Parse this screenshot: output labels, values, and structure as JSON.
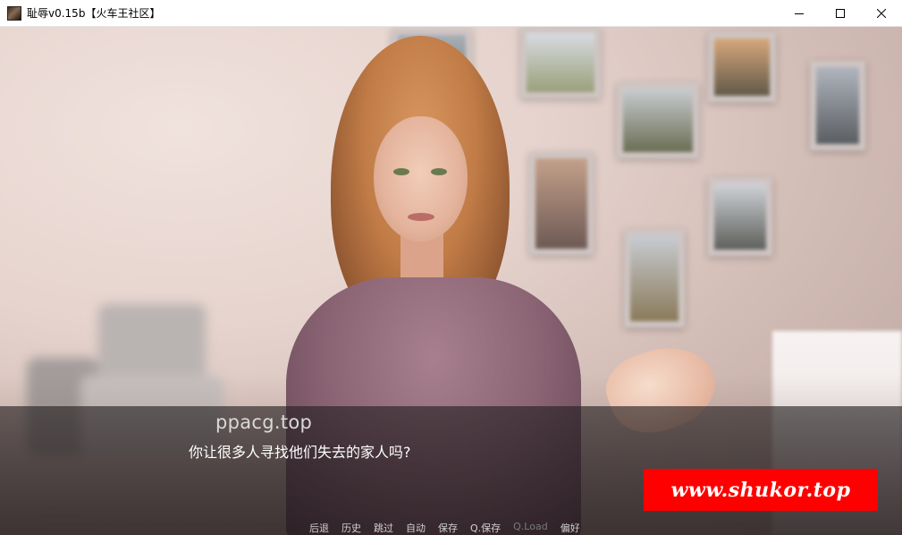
{
  "window": {
    "title": "耻辱v0.15b【火车王社区】",
    "controls": {
      "minimize_icon": "minimize-icon",
      "maximize_icon": "maximize-icon",
      "close_icon": "close-icon"
    }
  },
  "dialogue": {
    "speaker": "ppacg.top",
    "text": "你让很多人寻找他们失去的家人吗?"
  },
  "quick_menu": [
    {
      "label": "后退",
      "enabled": true
    },
    {
      "label": "历史",
      "enabled": true
    },
    {
      "label": "跳过",
      "enabled": true
    },
    {
      "label": "自动",
      "enabled": true
    },
    {
      "label": "保存",
      "enabled": true
    },
    {
      "label": "Q.保存",
      "enabled": true
    },
    {
      "label": "Q.Load",
      "enabled": false
    },
    {
      "label": "偏好",
      "enabled": true
    }
  ],
  "watermark": {
    "text": "www.shukor.top",
    "background": "#ff0000"
  }
}
